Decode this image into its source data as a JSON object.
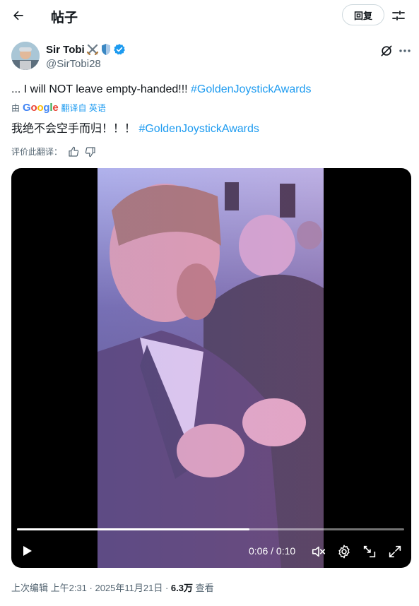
{
  "header": {
    "back_icon": "arrow-left-icon",
    "title": "帖子",
    "reply_label": "回复",
    "filter_icon": "sliders-icon"
  },
  "author": {
    "name": "Sir Tobi",
    "badges": [
      "crossed-swords-emoji",
      "shield-emoji",
      "verified-badge"
    ],
    "handle": "@SirTobi28"
  },
  "post": {
    "text_en": "... I will NOT leave empty-handed!!! ",
    "hashtag": "#GoldenJoystickAwards",
    "translate_by": "由",
    "translate_brand": "Google",
    "translate_from": "翻译自 英语",
    "text_zh": "我绝不会空手而归！！！ ",
    "hashtag_zh": "#GoldenJoystickAwards",
    "rate_label": "评价此翻译："
  },
  "video": {
    "current_time": "0:06",
    "separator": " / ",
    "duration": "0:10",
    "progress_fraction": 0.6,
    "muted": true
  },
  "meta": {
    "timestamp": "上次编辑 上午2:31 · 2025年11月21日 · ",
    "views": "6.3万",
    "views_label": " 查看"
  },
  "colors": {
    "accent": "#1d9bf0",
    "text": "#0f1419",
    "secondary": "#536471",
    "verified": "#1d9bf0"
  }
}
